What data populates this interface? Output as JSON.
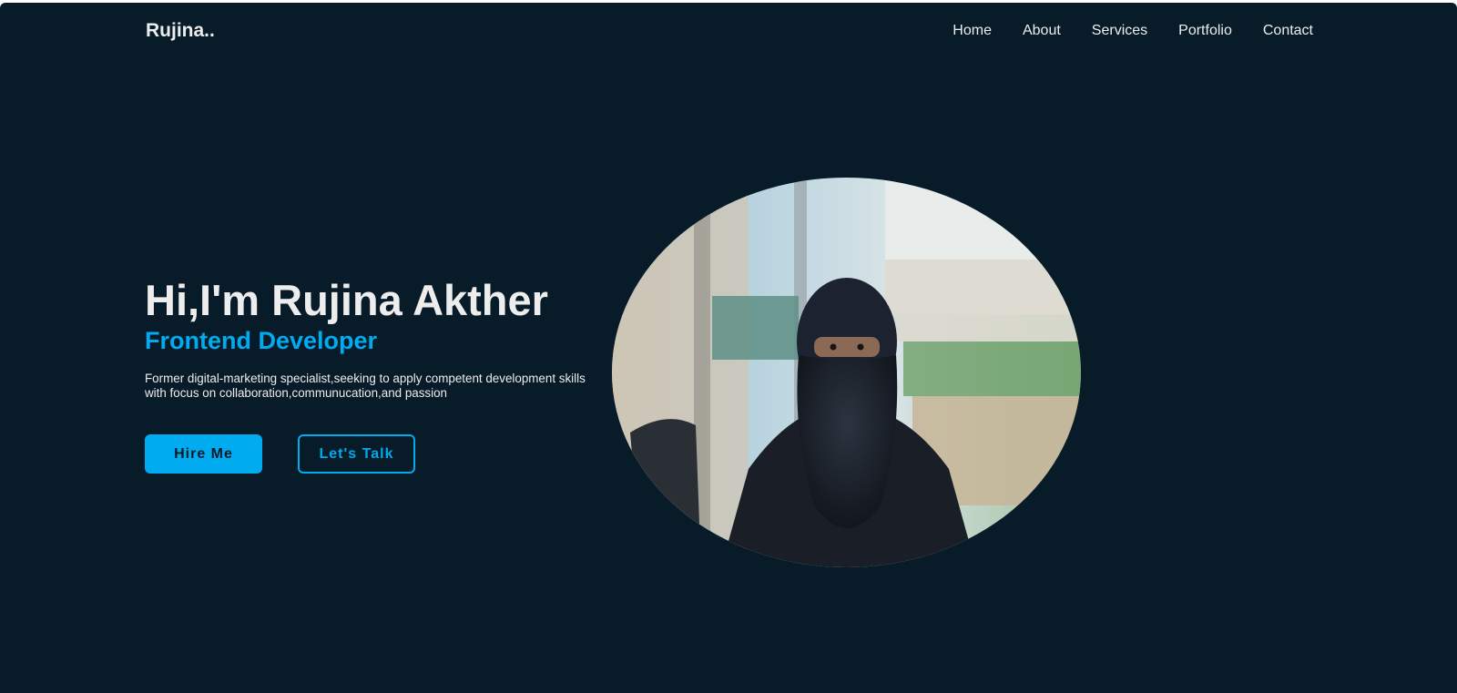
{
  "header": {
    "logo": "Rujina..",
    "nav": [
      "Home",
      "About",
      "Services",
      "Portfolio",
      "Contact"
    ]
  },
  "hero": {
    "greeting": "Hi,I'm Rujina Akther",
    "role": "Frontend Developer",
    "description": "Former digital-marketing specialist,seeking to apply competent development skills with focus on collaboration,communucation,and passion",
    "buttons": {
      "primary": "Hire Me",
      "secondary": "Let's Talk"
    },
    "photo": {
      "shape": "circle",
      "subject": "person in black niqab seated indoors by glass windows"
    }
  },
  "colors": {
    "background": "#081b29",
    "accent": "#00abf0",
    "text": "#ededed"
  }
}
